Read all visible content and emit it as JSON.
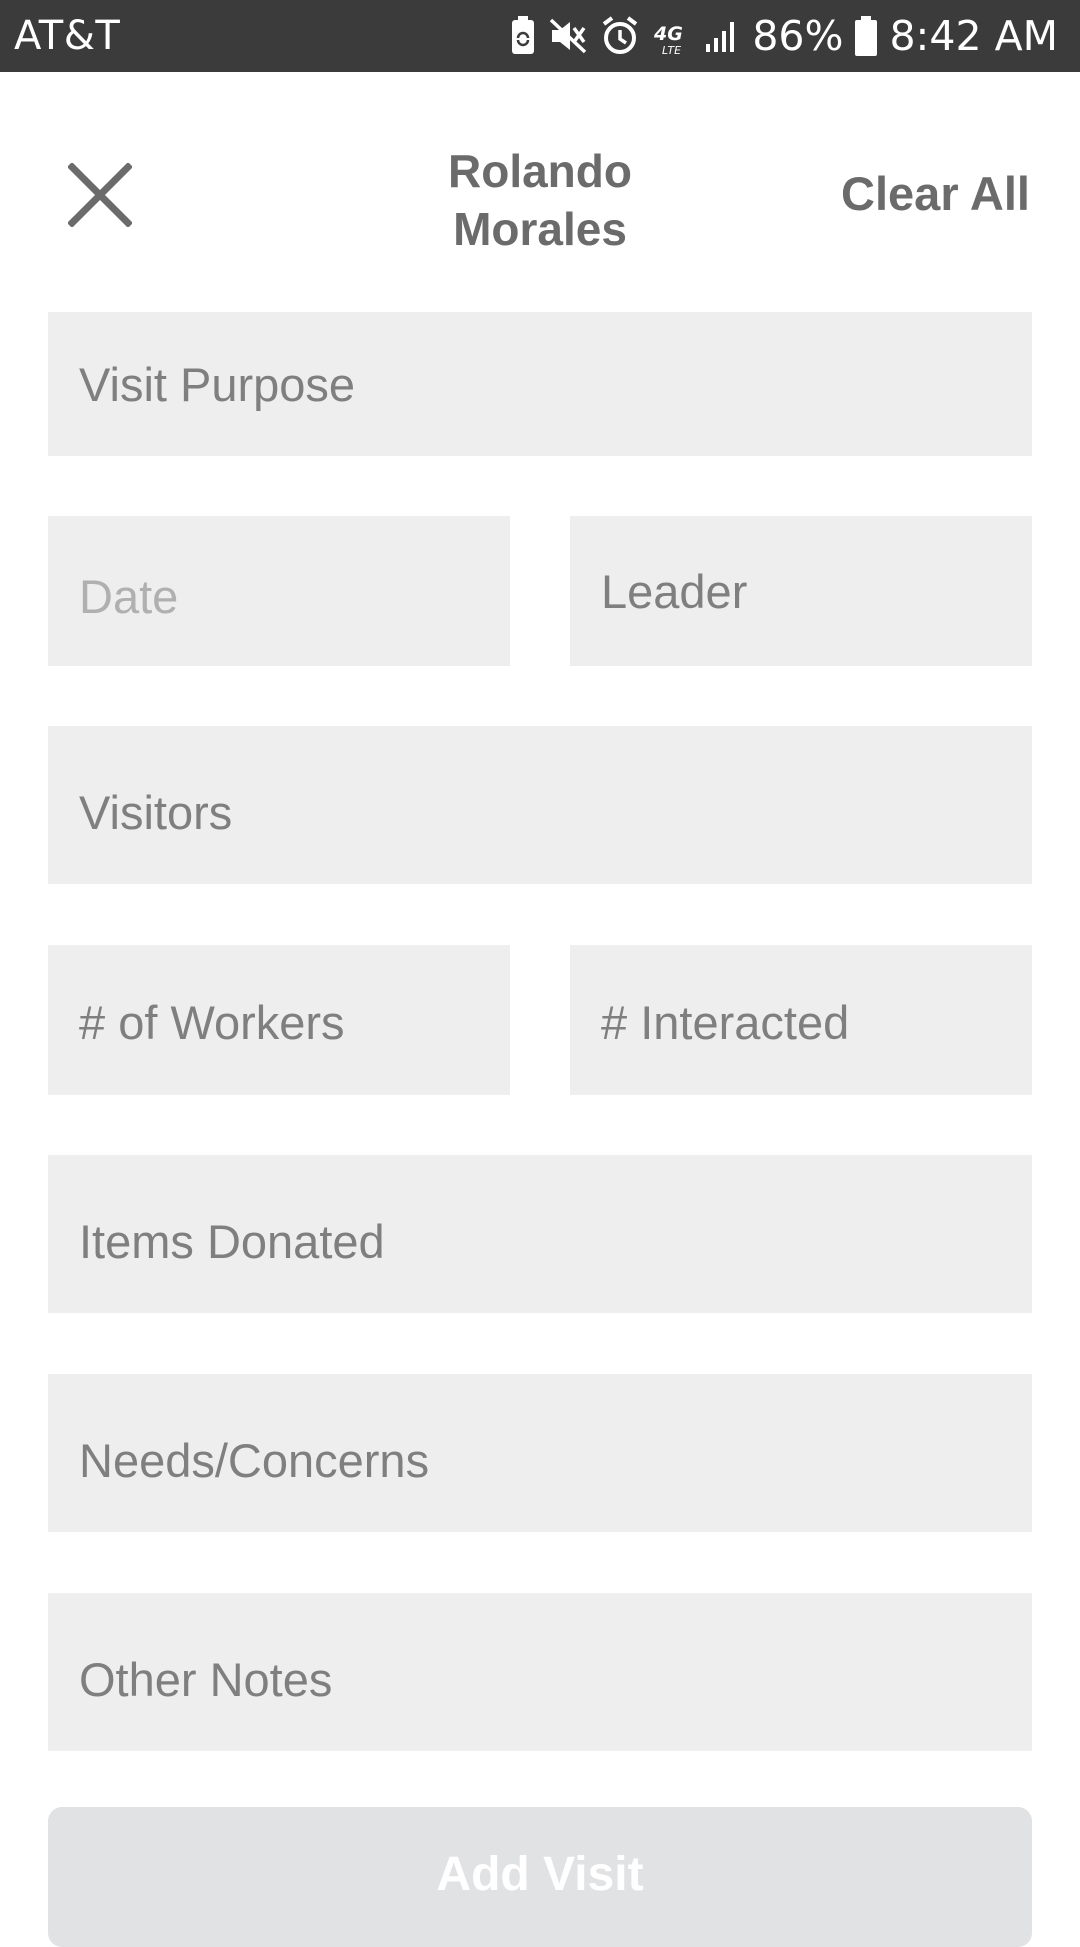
{
  "status_bar": {
    "carrier": "AT&T",
    "battery_percent": "86%",
    "time": "8:42 AM",
    "network_type": "4G LTE",
    "icons": [
      "battery-saver-icon",
      "vibrate-icon",
      "alarm-icon",
      "lte-icon",
      "signal-icon",
      "battery-icon"
    ]
  },
  "header": {
    "title_line1": "Rolando",
    "title_line2": "Morales",
    "clear_all_label": "Clear All",
    "close_icon": "close-icon"
  },
  "form": {
    "visit_purpose": "Visit Purpose",
    "date": "Date",
    "leader": "Leader",
    "visitors": "Visitors",
    "num_workers": "# of Workers",
    "num_interacted": "# Interacted",
    "items_donated": "Items Donated",
    "needs_concerns": "Needs/Concerns",
    "other_notes": "Other Notes"
  },
  "actions": {
    "add_visit_label": "Add Visit"
  },
  "colors": {
    "status_bar_bg": "#3b3b3b",
    "field_bg": "#eeeeee",
    "text_gray": "#6b6b6b",
    "placeholder_gray": "#7f7f7f",
    "button_bg_disabled": "#e1e2e4"
  }
}
